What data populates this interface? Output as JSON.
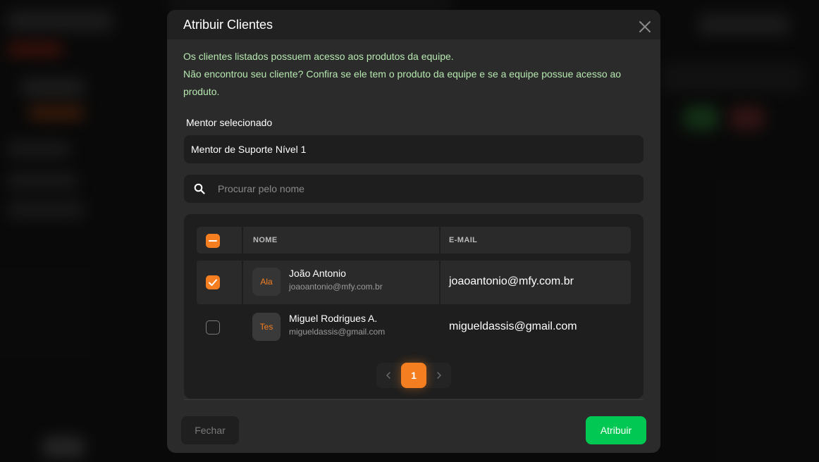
{
  "modal": {
    "title": "Atribuir Clientes",
    "info_line_1": "Os clientes listados possuem acesso aos produtos da equipe.",
    "info_line_2": "Não encontrou seu cliente? Confira se ele tem o produto da equipe e se a equipe possue acesso ao produto."
  },
  "mentor": {
    "label": "Mentor selecionado",
    "value": "Mentor de Suporte Nível 1"
  },
  "search": {
    "placeholder": "Procurar pelo nome",
    "value": ""
  },
  "table": {
    "headers": {
      "name": "NOME",
      "email": "E-MAIL"
    },
    "rows": [
      {
        "avatar": "Ala",
        "name": "João Antonio",
        "sub_email": "joaoantonio@mfy.com.br",
        "email": "joaoantonio@mfy.com.br",
        "checked": true
      },
      {
        "avatar": "Tes",
        "name": "Miguel Rodrigues A.",
        "sub_email": "migueldassis@gmail.com",
        "email": "migueldassis@gmail.com",
        "checked": false
      }
    ]
  },
  "pagination": {
    "current_page": "1"
  },
  "footer": {
    "close_label": "Fechar",
    "assign_label": "Atribuir"
  },
  "colors": {
    "accent": "#f57f20",
    "success": "#00c853",
    "info_text": "#b6e8b0"
  }
}
